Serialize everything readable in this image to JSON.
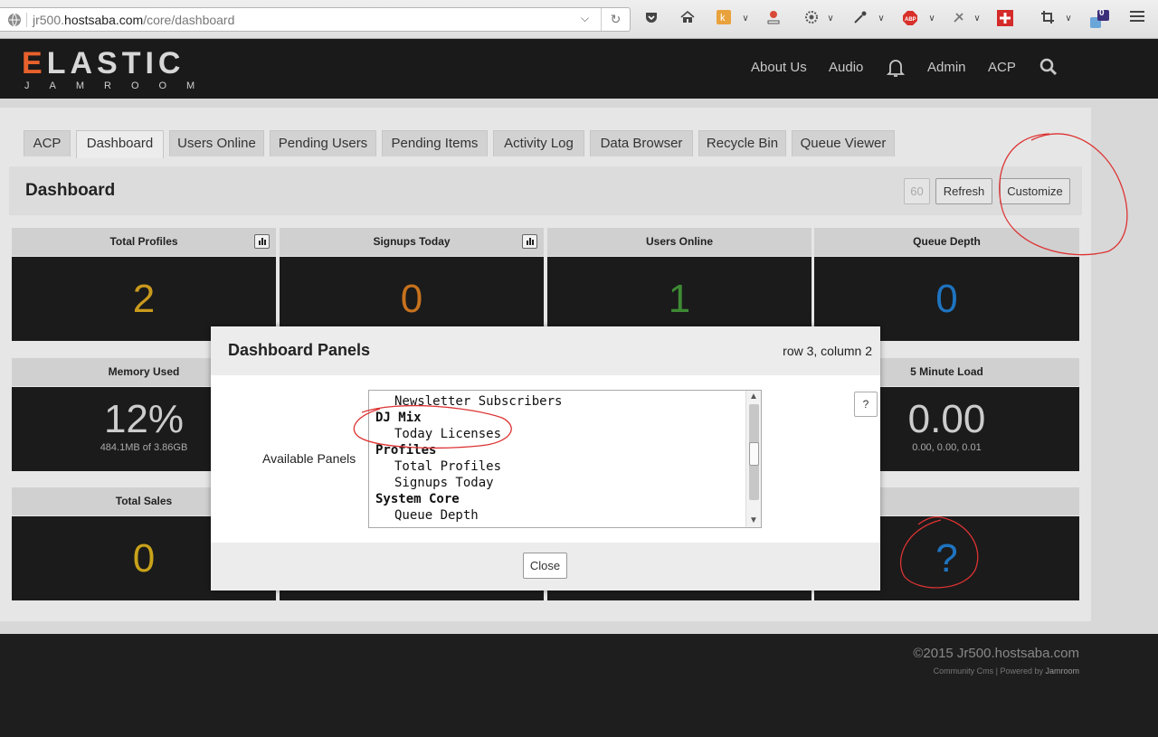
{
  "browser": {
    "url_prefix": "jr500.",
    "url_host": "hostsaba.com",
    "url_path": "/core/dashboard",
    "badge": "0"
  },
  "site": {
    "logo_main": "LASTIC",
    "logo_e": "E",
    "logo_sub": "JAMROOM",
    "nav": [
      "About Us",
      "Audio",
      "Admin",
      "ACP"
    ]
  },
  "tabs": [
    "ACP",
    "Dashboard",
    "Users Online",
    "Pending Users",
    "Pending Items",
    "Activity Log",
    "Data Browser",
    "Recycle Bin",
    "Queue Viewer"
  ],
  "dashboard": {
    "title": "Dashboard",
    "refresh_interval": "60",
    "refresh_label": "Refresh",
    "customize_label": "Customize"
  },
  "tiles": {
    "total_profiles": {
      "label": "Total Profiles",
      "value": "2",
      "color": "#c99a1c"
    },
    "signups_today": {
      "label": "Signups Today",
      "value": "0",
      "color": "#c7721d"
    },
    "users_online": {
      "label": "Users Online",
      "value": "1",
      "color": "#3e8a34"
    },
    "queue_depth": {
      "label": "Queue Depth",
      "value": "0",
      "color": "#1e74c0"
    },
    "memory_used": {
      "label": "Memory Used",
      "value": "12%",
      "sub": "484.1MB of 3.86GB",
      "color": "#cccccc"
    },
    "five_min_load": {
      "label": "5 Minute Load",
      "value": "0.00",
      "sub": "0.00, 0.00, 0.01",
      "color": "#cccccc"
    },
    "total_sales": {
      "label": "Total Sales",
      "value": "0",
      "color": "#c9a21a"
    },
    "unassigned": {
      "value": "?",
      "color": "#1e74c0"
    }
  },
  "modal": {
    "title": "Dashboard Panels",
    "location": "row 3, column 2",
    "field_label": "Available Panels",
    "help": "?",
    "close_label": "Close",
    "list": [
      {
        "text": "Newsletter Subscribers",
        "kind": "item"
      },
      {
        "text": "DJ Mix",
        "kind": "group"
      },
      {
        "text": "Today Licenses",
        "kind": "item"
      },
      {
        "text": "Profiles",
        "kind": "group"
      },
      {
        "text": "Total Profiles",
        "kind": "item"
      },
      {
        "text": "Signups Today",
        "kind": "item"
      },
      {
        "text": "System Core",
        "kind": "group"
      },
      {
        "text": "Queue Depth",
        "kind": "item"
      }
    ]
  },
  "footer": {
    "copyright": "©2015 Jr500.hostsaba.com",
    "cms": "Community Cms",
    "powered_prefix": "Powered by",
    "powered_name": "Jamroom"
  }
}
